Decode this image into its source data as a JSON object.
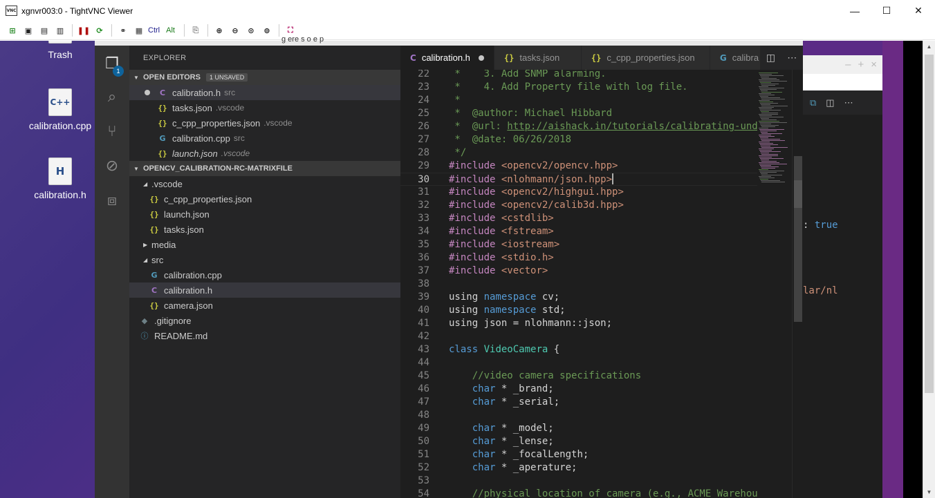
{
  "window": {
    "title": "xgnvr003:0 - TightVNC Viewer",
    "icon_text": "VNC"
  },
  "window_controls": {
    "minimize": "—",
    "maximize": "☐",
    "close": "✕"
  },
  "toolbar": {
    "ctrl_label": "Ctrl",
    "alt_label": "Alt"
  },
  "desktop": {
    "icons": [
      {
        "label": "Trash"
      },
      {
        "label": "calibration.cpp",
        "glyph": "C++"
      },
      {
        "label": "calibration.h",
        "glyph": "H"
      }
    ]
  },
  "vscode": {
    "explorer_title": "EXPLORER",
    "activity_badge": "1",
    "open_editors": {
      "title": "OPEN EDITORS",
      "badge": "1 UNSAVED",
      "items": [
        {
          "name": "calibration.h",
          "detail": "src",
          "icon": "C"
        },
        {
          "name": "tasks.json",
          "detail": ".vscode",
          "icon": "{}"
        },
        {
          "name": "c_cpp_properties.json",
          "detail": ".vscode",
          "icon": "{}"
        },
        {
          "name": "calibration.cpp",
          "detail": "src",
          "icon": "G"
        },
        {
          "name": "launch.json",
          "detail": ".vscode",
          "icon": "{}"
        }
      ]
    },
    "project": {
      "title": "OPENCV_CALIBRATION-RC-MATRIXFILE",
      "tree": [
        {
          "name": ".vscode"
        },
        {
          "name": "c_cpp_properties.json"
        },
        {
          "name": "launch.json"
        },
        {
          "name": "tasks.json"
        },
        {
          "name": "media"
        },
        {
          "name": "src"
        },
        {
          "name": "calibration.cpp"
        },
        {
          "name": "calibration.h"
        },
        {
          "name": "camera.json"
        },
        {
          "name": ".gitignore"
        },
        {
          "name": "README.md"
        }
      ]
    },
    "tabs": [
      {
        "label": "calibration.h"
      },
      {
        "label": "tasks.json"
      },
      {
        "label": "c_cpp_properties.json"
      },
      {
        "label": "calibra"
      }
    ],
    "editor": {
      "current_line": 30,
      "lines": [
        {
          "n": "22",
          "t": " *    3. Add SNMP alarming."
        },
        {
          "n": "23",
          "t": " *    4. Add Property file with log file."
        },
        {
          "n": "24",
          "t": " *"
        },
        {
          "n": "25",
          "t": " *  @author: Michael Hibbard"
        },
        {
          "n": "26",
          "t": " *  @url: ",
          "url": "http://aishack.in/tutorials/calibrating-und"
        },
        {
          "n": "27",
          "t": " *  @date: 06/26/2018"
        },
        {
          "n": "28",
          "t": " */"
        },
        {
          "n": "29",
          "kw": "#include",
          "str": " <opencv2/opencv.hpp>"
        },
        {
          "n": "30",
          "kw": "#include",
          "str": " <nlohmann/json.hpp>"
        },
        {
          "n": "31",
          "kw": "#include",
          "str": " <opencv2/highgui.hpp>"
        },
        {
          "n": "32",
          "kw": "#include",
          "str": " <opencv2/calib3d.hpp>"
        },
        {
          "n": "33",
          "kw": "#include",
          "str": " <cstdlib>"
        },
        {
          "n": "34",
          "kw": "#include",
          "str": " <fstream>"
        },
        {
          "n": "35",
          "kw": "#include",
          "str": " <iostream>"
        },
        {
          "n": "36",
          "kw": "#include",
          "str": " <stdio.h>"
        },
        {
          "n": "37",
          "kw": "#include",
          "str": " <vector>"
        },
        {
          "n": "38"
        },
        {
          "n": "39",
          "a": "using ",
          "b": "namespace",
          "c": " cv;"
        },
        {
          "n": "40",
          "a": "using ",
          "b": "namespace",
          "c": " std;"
        },
        {
          "n": "41",
          "a": "using json = nlohmann::json;"
        },
        {
          "n": "42"
        },
        {
          "n": "43",
          "b": "class",
          "ty": " VideoCamera",
          "c": " {"
        },
        {
          "n": "44"
        },
        {
          "n": "45",
          "t": "    //video camera specifications"
        },
        {
          "n": "46",
          "b": "    char",
          "c": " * _brand;"
        },
        {
          "n": "47",
          "b": "    char",
          "c": " * _serial;"
        },
        {
          "n": "48"
        },
        {
          "n": "49",
          "b": "    char",
          "c": " * _model;"
        },
        {
          "n": "50",
          "b": "    char",
          "c": " * _lense;"
        },
        {
          "n": "51",
          "b": "    char",
          "c": " * _focalLength;"
        },
        {
          "n": "52",
          "b": "    char",
          "c": " * _aperature;"
        },
        {
          "n": "53"
        },
        {
          "n": "54",
          "t": "    //physical location of camera (e.g., ACME Warehou"
        }
      ]
    }
  },
  "background_window": {
    "code_true": ": true",
    "code_path": "lar/nl"
  },
  "background_url_fragment": "g  ere s    o  e  p"
}
